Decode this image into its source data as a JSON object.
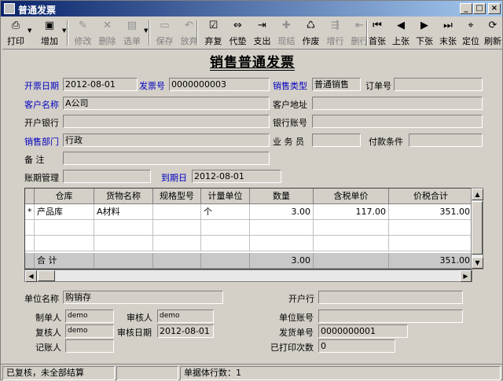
{
  "window": {
    "title": "普通发票"
  },
  "toolbar": [
    {
      "label": "打印",
      "icon": "printer-icon",
      "glyph": "⎙",
      "enabled": true,
      "dropdown": true
    },
    {
      "label": "增加",
      "icon": "add-doc-icon",
      "glyph": "▣",
      "enabled": true,
      "dropdown": true
    },
    {
      "label": "修改",
      "icon": "edit-icon",
      "glyph": "✎",
      "enabled": false
    },
    {
      "label": "删除",
      "icon": "delete-icon",
      "glyph": "✕",
      "enabled": false
    },
    {
      "label": "选单",
      "icon": "select-order-icon",
      "glyph": "▤",
      "enabled": false,
      "dropdown": true
    },
    {
      "label": "保存",
      "icon": "save-icon",
      "glyph": "▭",
      "enabled": false
    },
    {
      "label": "放弃",
      "icon": "undo-icon",
      "glyph": "↶",
      "enabled": false
    },
    {
      "label": "弃复",
      "icon": "restore-icon",
      "glyph": "☑",
      "enabled": true
    },
    {
      "label": "代垫",
      "icon": "advance-icon",
      "glyph": "⇔",
      "enabled": true
    },
    {
      "label": "支出",
      "icon": "expense-icon",
      "glyph": "⇥",
      "enabled": true
    },
    {
      "label": "现结",
      "icon": "cash-settle-icon",
      "glyph": "✚",
      "enabled": false
    },
    {
      "label": "作废",
      "icon": "trash-icon",
      "glyph": "♺",
      "enabled": true
    },
    {
      "label": "增行",
      "icon": "add-row-icon",
      "glyph": "⇶",
      "enabled": false
    },
    {
      "label": "删行",
      "icon": "delete-row-icon",
      "glyph": "⇤",
      "enabled": false
    },
    {
      "label": "首张",
      "icon": "first-icon",
      "glyph": "⏮",
      "enabled": true
    },
    {
      "label": "上张",
      "icon": "prev-icon",
      "glyph": "◀",
      "enabled": true
    },
    {
      "label": "下张",
      "icon": "next-icon",
      "glyph": "▶",
      "enabled": true
    },
    {
      "label": "末张",
      "icon": "last-icon",
      "glyph": "⏭",
      "enabled": true
    },
    {
      "label": "定位",
      "icon": "locate-icon",
      "glyph": "⌖",
      "enabled": true
    },
    {
      "label": "刷新",
      "icon": "refresh-icon",
      "glyph": "⟳",
      "enabled": true
    }
  ],
  "form": {
    "title": "销售普通发票",
    "invoice_date_label": "开票日期",
    "invoice_date": "2012-08-01",
    "invoice_no_label": "发票号",
    "invoice_no": "0000000003",
    "sales_type_label": "销售类型",
    "sales_type": "普通销售",
    "order_no_label": "订单号",
    "order_no": "",
    "customer_label": "客户名称",
    "customer": "A公司",
    "customer_addr_label": "客户地址",
    "customer_addr": "",
    "bank_label": "开户银行",
    "bank": "",
    "bank_account_label": "银行账号",
    "bank_account": "",
    "sales_dept_label": "销售部门",
    "sales_dept": "行政",
    "salesman_label": "业 务 员",
    "salesman": "",
    "payment_terms_label": "付款条件",
    "payment_terms": "",
    "remark_label": "备    注",
    "remark": "",
    "aging_label": "账期管理",
    "aging": "",
    "due_date_label": "到期日",
    "due_date": "2012-08-01"
  },
  "grid": {
    "columns": [
      "仓库",
      "货物名称",
      "规格型号",
      "计量单位",
      "数量",
      "含税单价",
      "价税合计"
    ],
    "rows": [
      {
        "marker": "*",
        "warehouse": "产品库",
        "item": "A材料",
        "spec": "",
        "unit": "个",
        "qty": "3.00",
        "price": "117.00",
        "total": "351.00"
      }
    ],
    "sum_label": "合  计",
    "sum_qty": "3.00",
    "sum_total": "351.00"
  },
  "footer": {
    "unit_name_label": "单位名称",
    "unit_name": "购销存",
    "bank_label": "开户行",
    "bank": "",
    "maker_label": "制单人",
    "maker": "demo",
    "checker_label": "审核人",
    "checker": "demo",
    "unit_account_label": "单位账号",
    "unit_account": "",
    "rechecker_label": "复核人",
    "rechecker": "demo",
    "check_date_label": "审核日期",
    "check_date": "2012-08-01",
    "ship_no_label": "发货单号",
    "ship_no": "0000000001",
    "bookkeeper_label": "记账人",
    "bookkeeper": "",
    "print_count_label": "已打印次数",
    "print_count": "0"
  },
  "status": {
    "pane1": "已复核，未全部结算",
    "pane2": "",
    "pane3": "单据体行数：1"
  }
}
